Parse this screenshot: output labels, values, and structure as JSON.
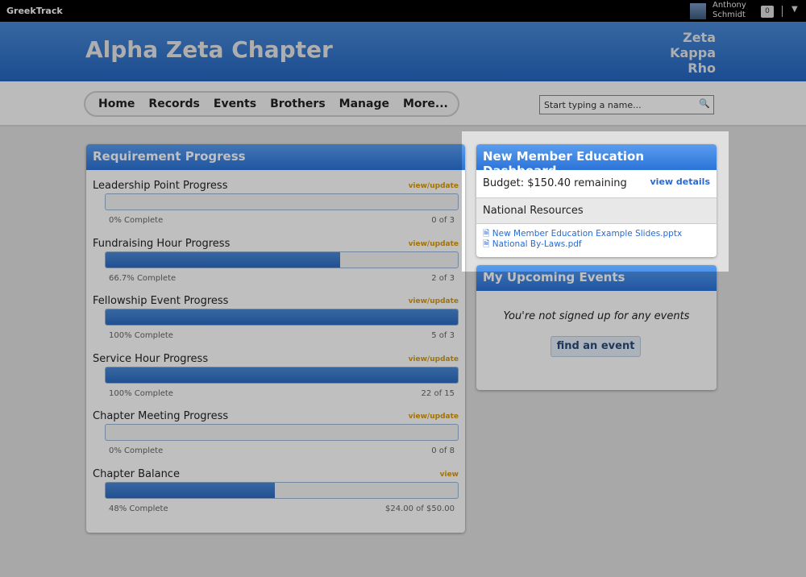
{
  "topbar": {
    "brand": "GreekTrack",
    "user_first": "Anthony",
    "user_last": "Schmidt",
    "notifications": "0"
  },
  "header": {
    "chapter": "Alpha Zeta Chapter",
    "org": [
      "Zeta",
      "Kappa",
      "Rho"
    ]
  },
  "nav": {
    "items": [
      "Home",
      "Records",
      "Events",
      "Brothers",
      "Manage",
      "More..."
    ],
    "search_placeholder": "Start typing a name..."
  },
  "requirements": {
    "title": "Requirement Progress",
    "rows": [
      {
        "label": "Leadership Point Progress",
        "link": "view/update",
        "percent": 0,
        "caption": "0% Complete",
        "count": "0 of 3"
      },
      {
        "label": "Fundraising Hour Progress",
        "link": "view/update",
        "percent": 66.7,
        "caption": "66.7% Complete",
        "count": "2 of 3"
      },
      {
        "label": "Fellowship Event Progress",
        "link": "view/update",
        "percent": 100,
        "caption": "100% Complete",
        "count": "5 of 3"
      },
      {
        "label": "Service Hour Progress",
        "link": "view/update",
        "percent": 100,
        "caption": "100% Complete",
        "count": "22 of 15"
      },
      {
        "label": "Chapter Meeting Progress",
        "link": "view/update",
        "percent": 0,
        "caption": "0% Complete",
        "count": "0 of 8"
      },
      {
        "label": "Chapter Balance",
        "link": "view",
        "percent": 48,
        "caption": "48% Complete",
        "count": "$24.00 of $50.00"
      }
    ]
  },
  "nme": {
    "title": "New Member Education Dashboard",
    "budget": "Budget: $150.40 remaining",
    "view_details": "view details",
    "resources_title": "National Resources",
    "files": [
      "New Member Education Example Slides.pptx",
      "National By-Laws.pdf"
    ]
  },
  "events": {
    "title": "My Upcoming Events",
    "empty": "You're not signed up for any events",
    "button": "find an event"
  }
}
